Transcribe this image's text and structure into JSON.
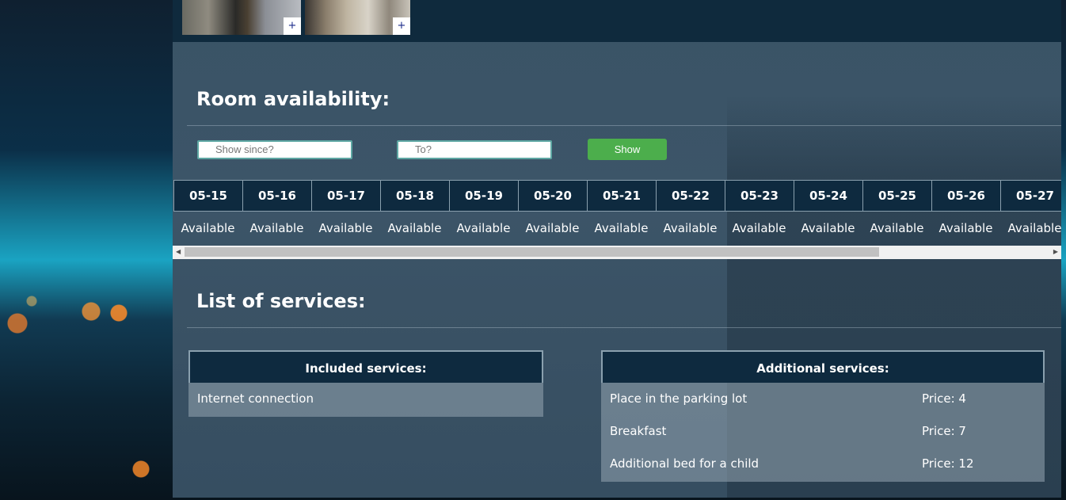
{
  "gallery": {
    "thumbs": [
      {
        "plus": "+"
      },
      {
        "plus": "+"
      }
    ]
  },
  "availability": {
    "title": "Room availability:",
    "since_placeholder": "Show since?",
    "to_placeholder": "To?",
    "show_label": "Show",
    "dates": [
      "05-15",
      "05-16",
      "05-17",
      "05-18",
      "05-19",
      "05-20",
      "05-21",
      "05-22",
      "05-23",
      "05-24",
      "05-25",
      "05-26",
      "05-27"
    ],
    "statuses": [
      "Available",
      "Available",
      "Available",
      "Available",
      "Available",
      "Available",
      "Available",
      "Available",
      "Available",
      "Available",
      "Available",
      "Available",
      "Available"
    ]
  },
  "services": {
    "title": "List of services:",
    "included": {
      "header": "Included services:",
      "items": [
        "Internet connection"
      ]
    },
    "additional": {
      "header": "Additional services:",
      "items": [
        {
          "name": "Place in the parking lot",
          "price": "Price: 4"
        },
        {
          "name": "Breakfast",
          "price": "Price: 7"
        },
        {
          "name": "Additional bed for a child",
          "price": "Price: 12"
        }
      ]
    }
  },
  "colors": {
    "panel": "#3a5366",
    "header_navy": "#0e2a3f",
    "show_button": "#4cae4c"
  }
}
